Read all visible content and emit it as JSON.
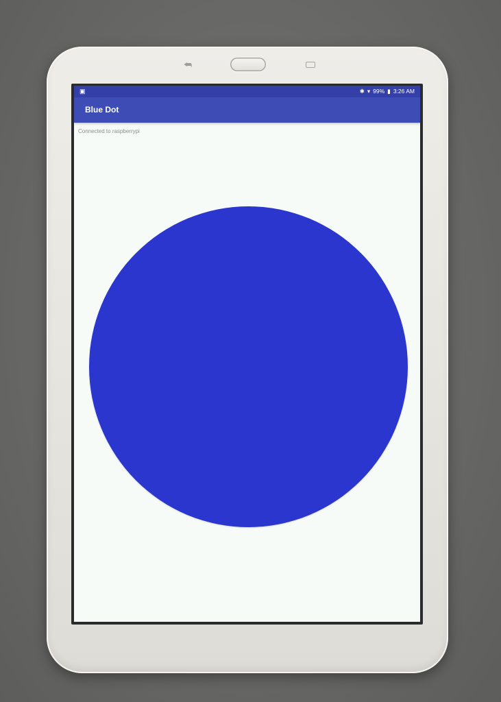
{
  "status_bar": {
    "left_icon": "lock-icon",
    "bluetooth_icon": "bluetooth-icon",
    "wifi_icon": "wifi-icon",
    "battery_percent": "99%",
    "battery_icon": "battery-icon",
    "time": "3:26 AM"
  },
  "app_bar": {
    "title": "Blue Dot"
  },
  "main": {
    "connection_status": "Connected to raspberrypi",
    "dot_color": "#2b36cf"
  }
}
